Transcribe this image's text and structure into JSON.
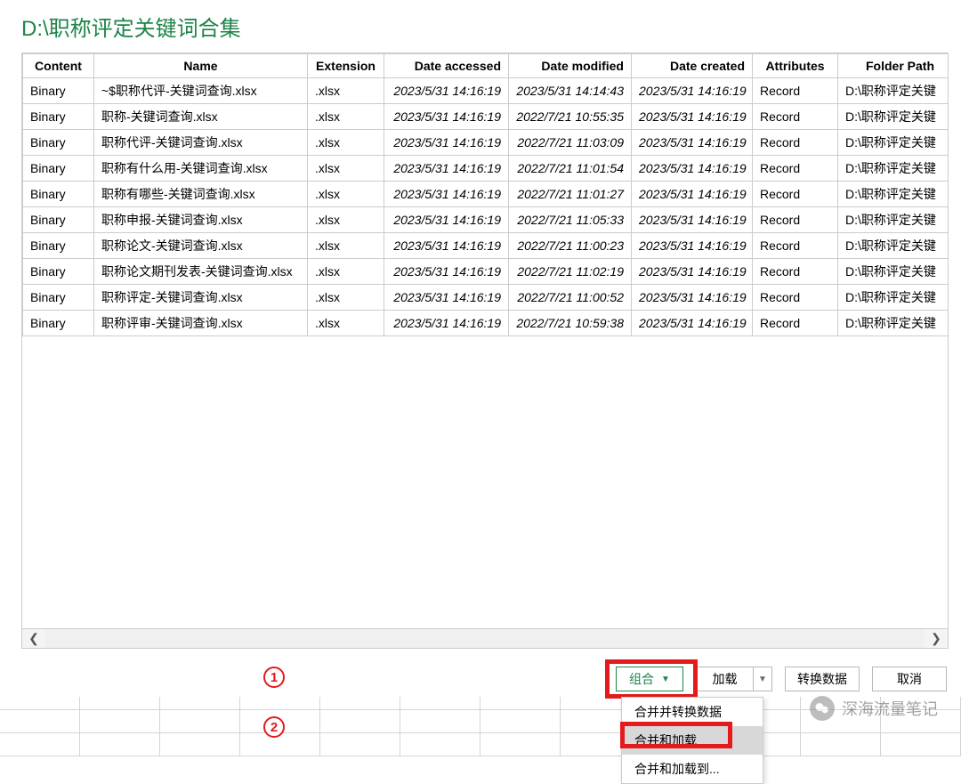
{
  "title": "D:\\职称评定关键词合集",
  "columns": {
    "content": "Content",
    "name": "Name",
    "extension": "Extension",
    "date_accessed": "Date accessed",
    "date_modified": "Date modified",
    "date_created": "Date created",
    "attributes": "Attributes",
    "folder_path": "Folder Path"
  },
  "rows": [
    {
      "content": "Binary",
      "name": "~$职称代评-关键词查询.xlsx",
      "ext": ".xlsx",
      "da": "2023/5/31 14:16:19",
      "dm": "2023/5/31 14:14:43",
      "dc": "2023/5/31 14:16:19",
      "attr": "Record",
      "folder": "D:\\职称评定关键"
    },
    {
      "content": "Binary",
      "name": "职称-关键词查询.xlsx",
      "ext": ".xlsx",
      "da": "2023/5/31 14:16:19",
      "dm": "2022/7/21 10:55:35",
      "dc": "2023/5/31 14:16:19",
      "attr": "Record",
      "folder": "D:\\职称评定关键"
    },
    {
      "content": "Binary",
      "name": "职称代评-关键词查询.xlsx",
      "ext": ".xlsx",
      "da": "2023/5/31 14:16:19",
      "dm": "2022/7/21 11:03:09",
      "dc": "2023/5/31 14:16:19",
      "attr": "Record",
      "folder": "D:\\职称评定关键"
    },
    {
      "content": "Binary",
      "name": "职称有什么用-关键词查询.xlsx",
      "ext": ".xlsx",
      "da": "2023/5/31 14:16:19",
      "dm": "2022/7/21 11:01:54",
      "dc": "2023/5/31 14:16:19",
      "attr": "Record",
      "folder": "D:\\职称评定关键"
    },
    {
      "content": "Binary",
      "name": "职称有哪些-关键词查询.xlsx",
      "ext": ".xlsx",
      "da": "2023/5/31 14:16:19",
      "dm": "2022/7/21 11:01:27",
      "dc": "2023/5/31 14:16:19",
      "attr": "Record",
      "folder": "D:\\职称评定关键"
    },
    {
      "content": "Binary",
      "name": "职称申报-关键词查询.xlsx",
      "ext": ".xlsx",
      "da": "2023/5/31 14:16:19",
      "dm": "2022/7/21 11:05:33",
      "dc": "2023/5/31 14:16:19",
      "attr": "Record",
      "folder": "D:\\职称评定关键"
    },
    {
      "content": "Binary",
      "name": "职称论文-关键词查询.xlsx",
      "ext": ".xlsx",
      "da": "2023/5/31 14:16:19",
      "dm": "2022/7/21 11:00:23",
      "dc": "2023/5/31 14:16:19",
      "attr": "Record",
      "folder": "D:\\职称评定关键"
    },
    {
      "content": "Binary",
      "name": "职称论文期刊发表-关键词查询.xlsx",
      "ext": ".xlsx",
      "da": "2023/5/31 14:16:19",
      "dm": "2022/7/21 11:02:19",
      "dc": "2023/5/31 14:16:19",
      "attr": "Record",
      "folder": "D:\\职称评定关键"
    },
    {
      "content": "Binary",
      "name": "职称评定-关键词查询.xlsx",
      "ext": ".xlsx",
      "da": "2023/5/31 14:16:19",
      "dm": "2022/7/21 11:00:52",
      "dc": "2023/5/31 14:16:19",
      "attr": "Record",
      "folder": "D:\\职称评定关键"
    },
    {
      "content": "Binary",
      "name": "职称评审-关键词查询.xlsx",
      "ext": ".xlsx",
      "da": "2023/5/31 14:16:19",
      "dm": "2022/7/21 10:59:38",
      "dc": "2023/5/31 14:16:19",
      "attr": "Record",
      "folder": "D:\\职称评定关键"
    }
  ],
  "buttons": {
    "combine": "组合",
    "load": "加载",
    "transform": "转换数据",
    "cancel": "取消"
  },
  "dropdown": {
    "item1": "合并并转换数据",
    "item2": "合并和加载",
    "item3": "合并和加载到..."
  },
  "annotations": {
    "one": "1",
    "two": "2"
  },
  "watermark": {
    "text": "深海流量笔记"
  },
  "scroll": {
    "left_glyph": "❮",
    "right_glyph": "❯"
  },
  "caret_glyph": "▼"
}
